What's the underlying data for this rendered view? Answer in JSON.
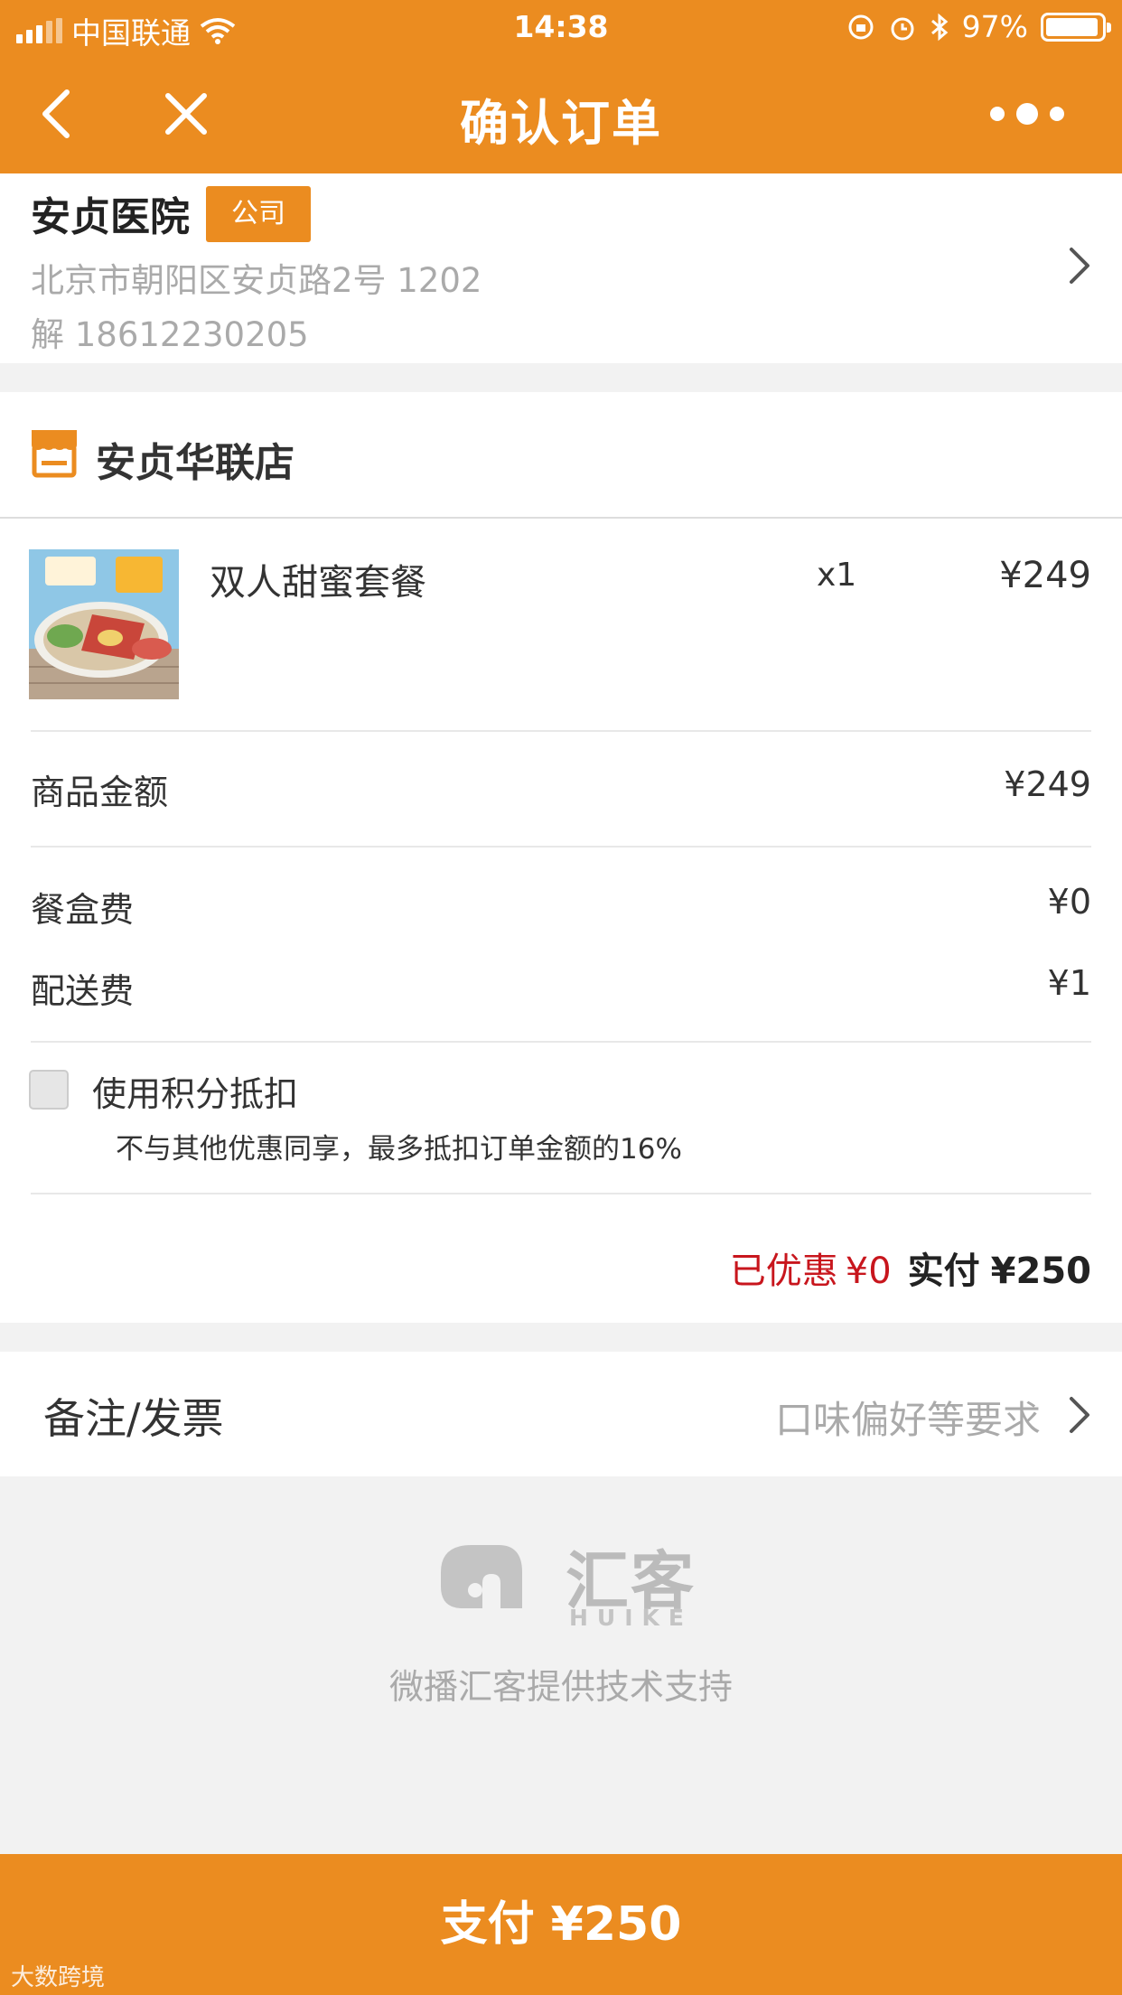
{
  "status_bar": {
    "carrier": "中国联通",
    "time": "14:38",
    "battery": "97%"
  },
  "nav": {
    "title": "确认订单",
    "back_icon": "chevron-left-icon",
    "close_icon": "close-icon",
    "more_icon": "more-dots-icon"
  },
  "address": {
    "name": "安贞医院",
    "tag": "公司",
    "line": "北京市朝阳区安贞路2号 1202",
    "contact": "解 18612230205"
  },
  "store": {
    "name": "安贞华联店",
    "items": [
      {
        "name": "双人甜蜜套餐",
        "qty": "x1",
        "price": "¥249"
      }
    ],
    "subtotal_label": "商品金额",
    "subtotal_value": "¥249",
    "box_fee_label": "餐盒费",
    "box_fee_value": "¥0",
    "delivery_fee_label": "配送费",
    "delivery_fee_value": "¥1",
    "points_label": "使用积分抵扣",
    "points_note": "不与其他优惠同享，最多抵扣订单金额的16%",
    "points_checked": false,
    "discount_label": "已优惠",
    "discount_value": "¥0",
    "paid_label": "实付",
    "paid_value": "¥250"
  },
  "notes": {
    "label": "备注/发票",
    "placeholder": "口味偏好等要求"
  },
  "brand": {
    "name_cn": "汇客",
    "name_en": "HUIKE",
    "powered_by": "微播汇客提供技术支持"
  },
  "pay_button": {
    "label": "支付 ¥250"
  },
  "watermark": "大数跨境",
  "colors": {
    "accent": "#eb8c20",
    "discount_red": "#c8161d"
  }
}
